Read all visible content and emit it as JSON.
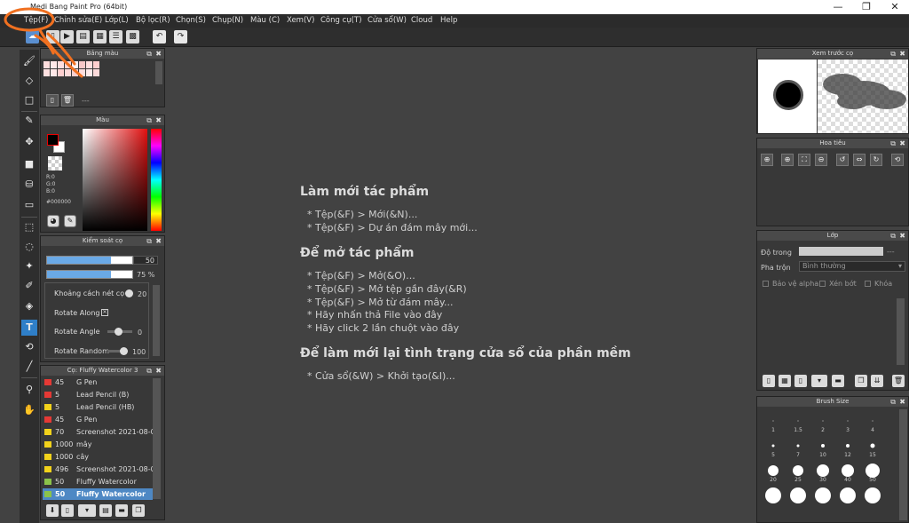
{
  "window": {
    "title": "Medi Bang Paint Pro (64bit)",
    "min": "—",
    "max": "❐",
    "close": "✕"
  },
  "menu": [
    "Tệp(F)",
    "Chỉnh sửa(E)",
    "Lớp(L)",
    "Bộ lọc(R)",
    "Chọn(S)",
    "Chụp(N)",
    "Màu (C)",
    "Xem(V)",
    "Công cụ(T)",
    "Cửa sổ(W)",
    "Cloud",
    "Help"
  ],
  "toolbar": {
    "undo": "↶",
    "redo": "↷"
  },
  "panels": {
    "palette": {
      "title": "Bảng màu",
      "footer": "---"
    },
    "color": {
      "title": "Màu",
      "r": "R:0",
      "g": "G:0",
      "b": "B:0",
      "hex": "#000000"
    },
    "brush_ctrl": {
      "title": "Kiểm soát cọ",
      "size": "50",
      "size_fill": 0.75,
      "opacity": "75 %",
      "opacity_fill": 0.75,
      "spacing_label": "Khoảng cách nét cọ",
      "spacing_val": "20",
      "rot_along": "Rotate Along",
      "rot_angle": "Rotate Angle",
      "rot_angle_val": "0",
      "rot_random": "Rotate Random",
      "rot_random_val": "100"
    },
    "brushes": {
      "title": "Cọ: Fluffy Watercolor 3",
      "items": [
        {
          "n": "45",
          "name": "G Pen",
          "color": "#e53935"
        },
        {
          "n": "5",
          "name": "Lead Pencil (B)",
          "color": "#e53935"
        },
        {
          "n": "5",
          "name": "Lead Pencil (HB)",
          "color": "#f2d21b"
        },
        {
          "n": "45",
          "name": "G Pen",
          "color": "#e53935"
        },
        {
          "n": "70",
          "name": "Screenshot 2021-08-0",
          "color": "#f2d21b"
        },
        {
          "n": "1000",
          "name": "mây",
          "color": "#f2d21b"
        },
        {
          "n": "1000",
          "name": "cây",
          "color": "#f2d21b"
        },
        {
          "n": "496",
          "name": "Screenshot 2021-08-0",
          "color": "#f2d21b"
        },
        {
          "n": "50",
          "name": "Fluffy Watercolor",
          "color": "#8bc34a"
        },
        {
          "n": "50",
          "name": "Fluffy Watercolor",
          "color": "#8bc34a",
          "selected": true
        }
      ]
    },
    "preview": {
      "title": "Xem trước cọ"
    },
    "navigator": {
      "title": "Hoa tiêu"
    },
    "layer": {
      "title": "Lớp",
      "opacity_label": "Độ trong",
      "opacity_val": "---",
      "blend_label": "Pha trộn",
      "blend_val": "Bình thường",
      "protect": "Bảo vệ alpha",
      "clip": "Xén bớt",
      "lock": "Khóa"
    },
    "brush_size": {
      "title": "Brush Size",
      "sizes": [
        "1",
        "1.5",
        "2",
        "3",
        "4",
        "5",
        "7",
        "10",
        "12",
        "15",
        "20",
        "25",
        "30",
        "40",
        "50",
        "",
        "",
        "",
        "",
        ""
      ]
    }
  },
  "canvas": {
    "h1": "Làm mới tác phẩm",
    "l1": "* Tệp(&F) > Mới(&N)...",
    "l2": "* Tệp(&F) > Dự án đám mây mới...",
    "h2": "Để mở tác phẩm",
    "l3": "* Tệp(&F) > Mở(&O)...",
    "l4": "* Tệp(&F) > Mở tệp gần đây(&R)",
    "l5": "* Tệp(&F) > Mở từ đám mây...",
    "l6": "* Hãy nhấn thả File vào đây",
    "l7": "* Hãy click 2 lần chuột vào đây",
    "h3": "Để làm mới lại tình trạng cửa sổ của phần mềm",
    "l8": "* Cửa sổ(&W) > Khởi tạo(&I)..."
  },
  "colors": {
    "annotation": "#f07020",
    "accent": "#2f7fc8"
  }
}
